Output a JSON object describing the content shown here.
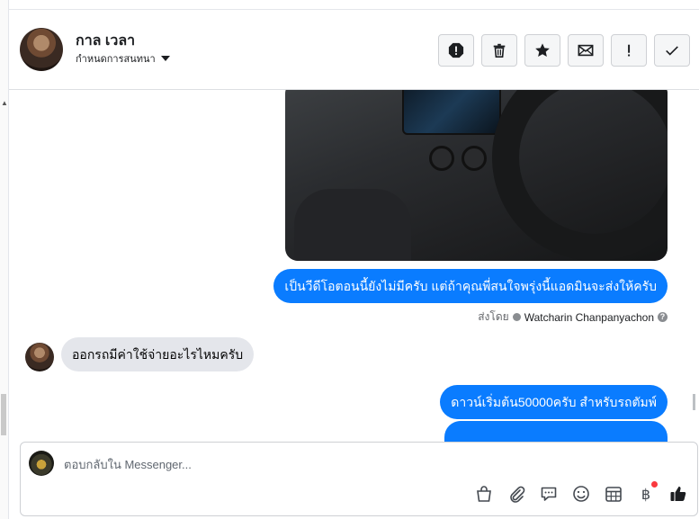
{
  "header": {
    "contact_name": "กาล เวลา",
    "assign_label": "กำหนดการสนทนา",
    "actions": [
      {
        "name": "report-icon"
      },
      {
        "name": "trash-icon"
      },
      {
        "name": "star-icon"
      },
      {
        "name": "envelope-icon"
      },
      {
        "name": "exclamation-icon"
      },
      {
        "name": "check-icon"
      }
    ]
  },
  "conversation": {
    "messages": [
      {
        "direction": "out",
        "text": "เป็นวีดีโอตอนนี้ยังไม่มีครับ แต่ถ้าคุณพี่สนใจพรุ่งนี้แอดมินจะส่งให้ครับ"
      },
      {
        "direction": "in",
        "text": "ออกรถมีค่าใช้จ่ายอะไรไหมครับ"
      },
      {
        "direction": "out",
        "text": "ดาวน์เริ่มต้น50000ครับ สำหรับรถตัมพ์"
      }
    ],
    "sent_by_label": "ส่งโดย",
    "sent_by_name": "Watcharin Chanpanyachon",
    "help_glyph": "?"
  },
  "composer": {
    "placeholder": "ตอบกลับใน Messenger...",
    "baht_symbol": "฿"
  },
  "colors": {
    "outgoing_bubble": "#0a7cff",
    "incoming_bubble": "#e4e6eb",
    "notification_dot": "#fa383e"
  }
}
